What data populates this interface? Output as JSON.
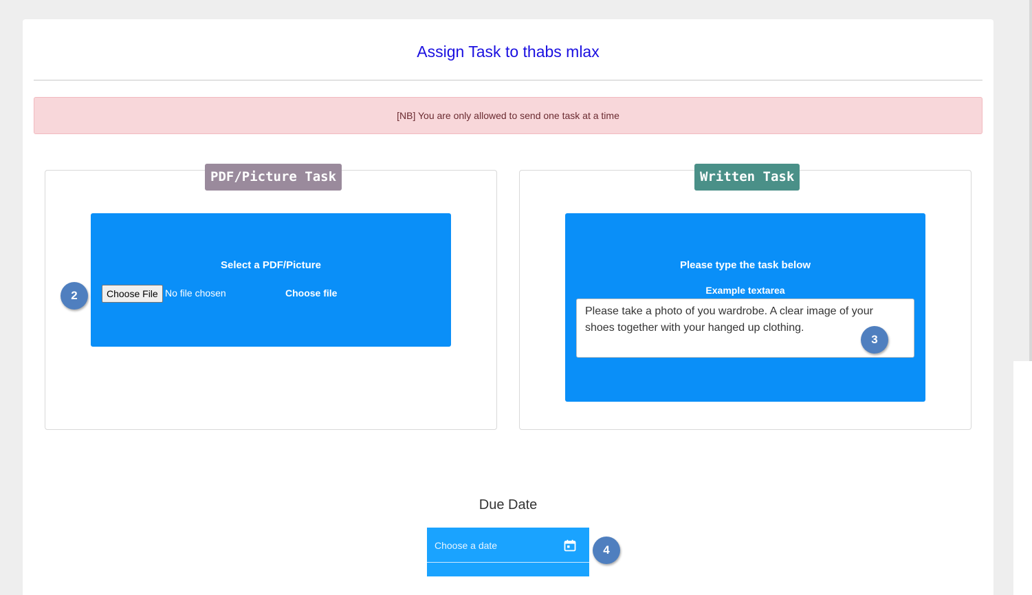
{
  "page": {
    "title": "Assign Task to thabs mlax",
    "notice": "[NB] You are only allowed to send one task at a time"
  },
  "pdf_task": {
    "badge": "PDF/Picture Task",
    "heading": "Select a PDF/Picture",
    "choose_button": "Choose File",
    "file_status": "No file chosen",
    "file_label": "Choose file"
  },
  "written_task": {
    "badge": "Written Task",
    "heading": "Please type the task below",
    "textarea_label": "Example textarea",
    "textarea_value": "Please take a photo of you wardrobe. A clear image of your shoes together with your hanged up clothing."
  },
  "due_date": {
    "label": "Due Date",
    "placeholder": "Choose a date",
    "icon": "calendar-icon"
  },
  "steps": [
    "2",
    "3",
    "4"
  ],
  "colors": {
    "title": "#1a0fe0",
    "alert_bg": "#f8d7da",
    "blue_box": "#0a8ff8",
    "pdf_badge": "#9a8a9c",
    "written_badge": "#4a9088",
    "date_field": "#1aa3ff",
    "step_marker": "#4f7fbf"
  }
}
